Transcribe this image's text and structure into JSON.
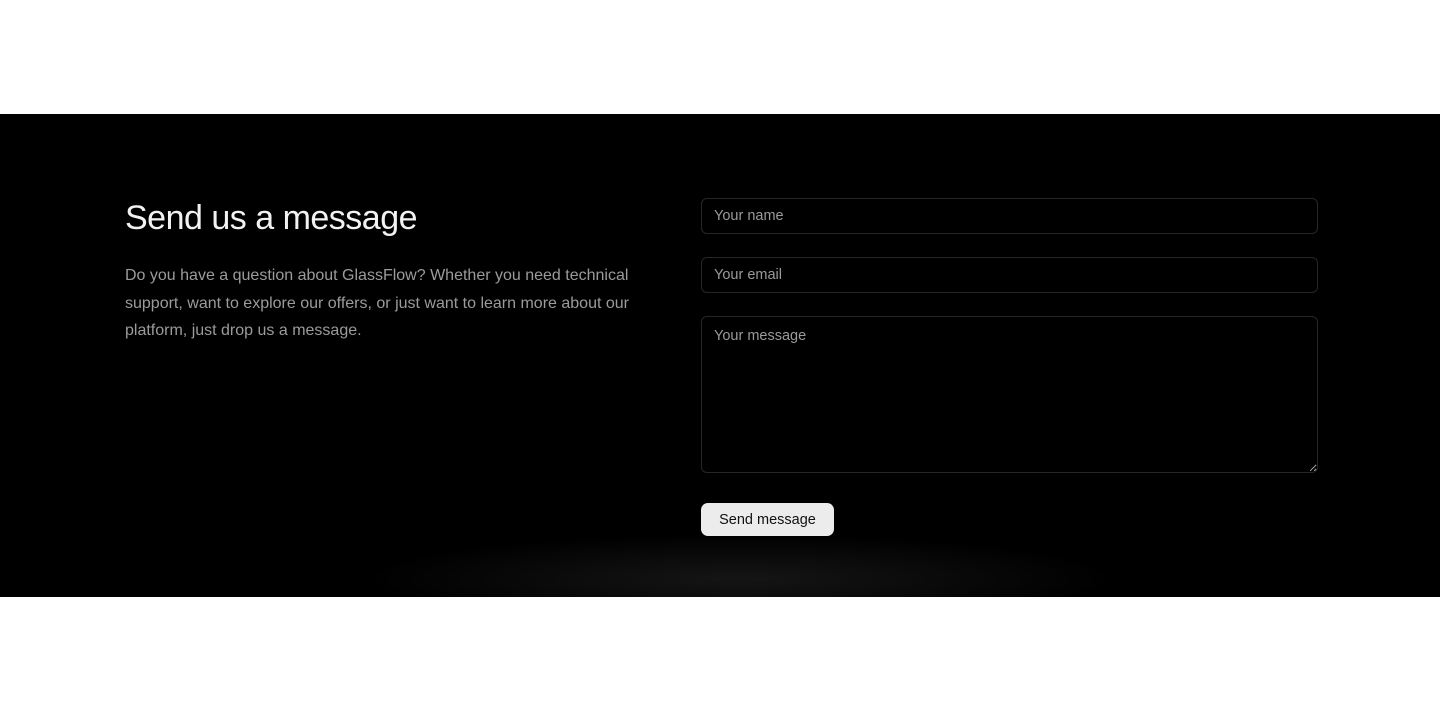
{
  "contact": {
    "title": "Send us a message",
    "description": "Do you have a question about GlassFlow? Whether you need technical support, want to explore our offers, or just want to learn more about our platform, just drop us a message."
  },
  "form": {
    "name_placeholder": "Your name",
    "email_placeholder": "Your email",
    "message_placeholder": "Your message",
    "submit_label": "Send message"
  },
  "colors": {
    "section_background": "#000000",
    "page_background": "#ffffff",
    "button_background": "#ececec",
    "title_text": "#f2f2f2",
    "body_text": "#9b9b9b"
  }
}
